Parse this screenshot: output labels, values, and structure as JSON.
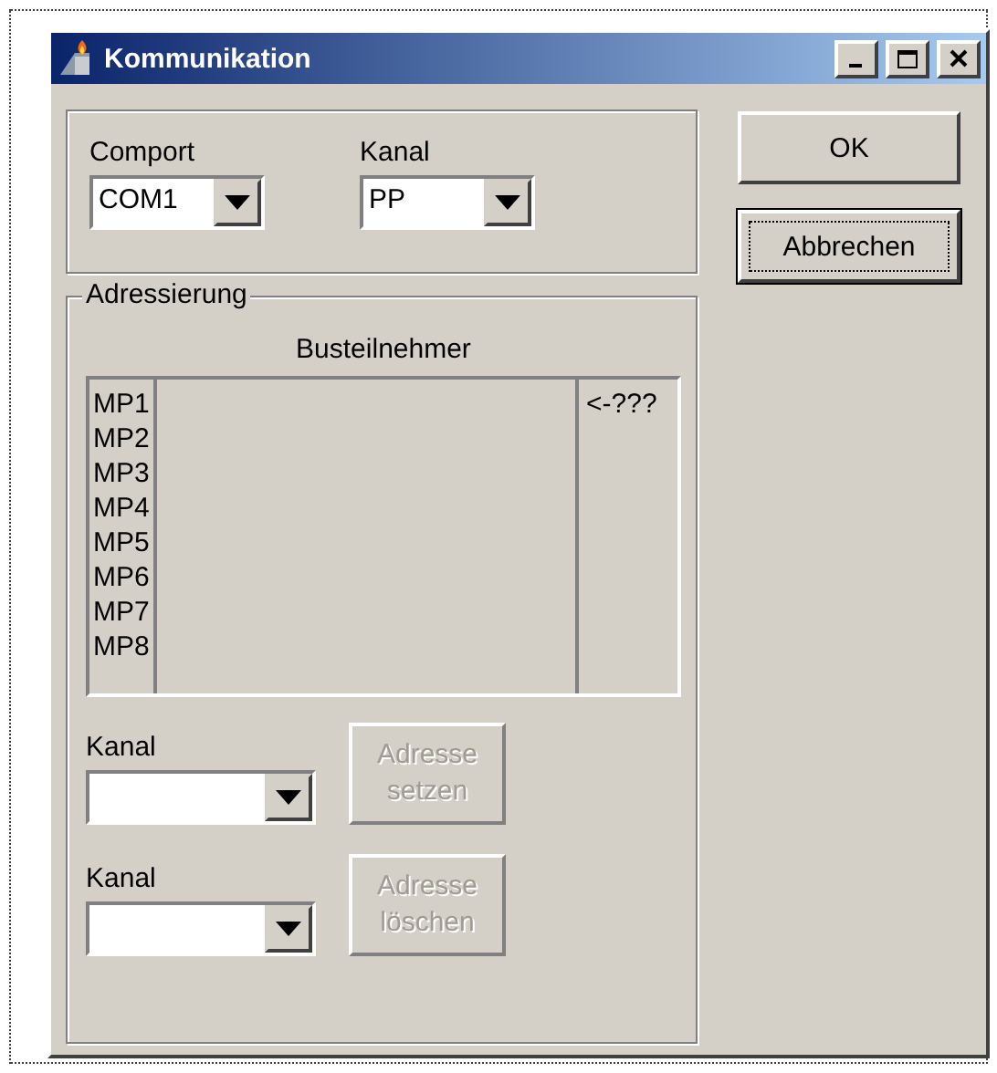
{
  "window": {
    "title": "Kommunikation"
  },
  "connection": {
    "fields": [
      {
        "label": "Comport",
        "value": "COM1"
      },
      {
        "label": "Kanal",
        "value": "PP"
      }
    ]
  },
  "buttons": [
    {
      "label": "OK",
      "focused": false
    },
    {
      "label": "Abbrechen",
      "focused": true
    }
  ],
  "addressing": {
    "title": "Adressierung",
    "list_title": "Busteilnehmer",
    "items": [
      {
        "name": "MP1",
        "status": "<-???"
      },
      {
        "name": "MP2"
      },
      {
        "name": "MP3"
      },
      {
        "name": "MP4"
      },
      {
        "name": "MP5"
      },
      {
        "name": "MP6"
      },
      {
        "name": "MP7"
      },
      {
        "name": "MP8"
      }
    ],
    "actions": [
      {
        "label": "Kanal",
        "button": "Adresse setzen",
        "disabled": true
      },
      {
        "label": "Kanal",
        "button": "Adresse löschen",
        "disabled": true
      }
    ]
  }
}
